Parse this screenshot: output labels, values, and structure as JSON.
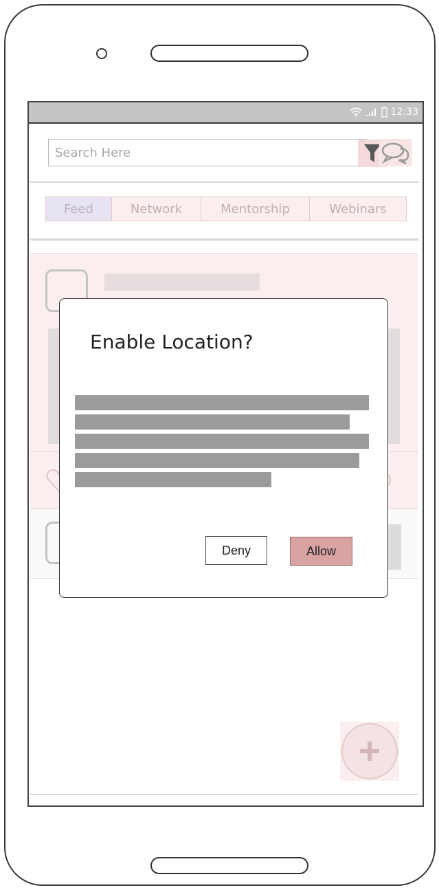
{
  "status_bar": {
    "time": "12:33"
  },
  "search": {
    "placeholder": "Search Here"
  },
  "tabs": [
    {
      "label": "Feed",
      "active": true
    },
    {
      "label": "Network",
      "active": false
    },
    {
      "label": "Mentorship",
      "active": false
    },
    {
      "label": "Webinars",
      "active": false
    }
  ],
  "dialog": {
    "title": "Enable Location?",
    "deny_label": "Deny",
    "allow_label": "Allow"
  },
  "icons": {
    "filter": "filter-icon",
    "chat": "chat-icon",
    "add": "plus-icon",
    "wifi": "wifi-icon",
    "signal": "signal-icon",
    "battery": "battery-icon"
  },
  "colors": {
    "accent": "#d9a3a3",
    "card_background": "#fbeeee",
    "active_tab": "#e8e3f2",
    "status_bar": "#c4c4c4"
  }
}
